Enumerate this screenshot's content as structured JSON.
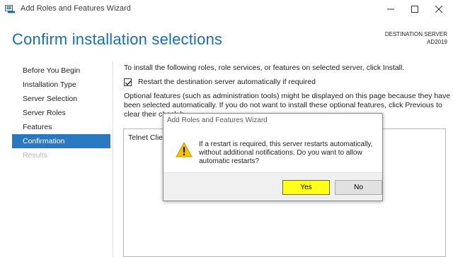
{
  "window": {
    "title": "Add Roles and Features Wizard"
  },
  "header": {
    "page_title": "Confirm installation selections",
    "destination_label": "DESTINATION SERVER",
    "destination_server": "AD2019"
  },
  "nav": {
    "items": [
      {
        "label": "Before You Begin",
        "state": "normal"
      },
      {
        "label": "Installation Type",
        "state": "normal"
      },
      {
        "label": "Server Selection",
        "state": "normal"
      },
      {
        "label": "Server Roles",
        "state": "normal"
      },
      {
        "label": "Features",
        "state": "normal"
      },
      {
        "label": "Confirmation",
        "state": "active"
      },
      {
        "label": "Results",
        "state": "disabled"
      }
    ]
  },
  "main": {
    "intro": "To install the following roles, role services, or features on selected server, click Install.",
    "restart_checkbox": {
      "label": "Restart the destination server automatically if required",
      "checked": true
    },
    "optional_text": "Optional features (such as administration tools) might be displayed on this page because they have been selected automatically. If you do not want to install these optional features, click Previous to clear their check b",
    "features": [
      "Telnet Client"
    ]
  },
  "dialog": {
    "title": "Add Roles and Features Wizard",
    "icon": "warning-icon",
    "message": "If a restart is required, this server restarts automatically, without additional notifications. Do you want to allow automatic restarts?",
    "yes_label": "Yes",
    "no_label": "No"
  },
  "colors": {
    "accent": "#1a6fa8",
    "nav_active": "#2a78c0",
    "highlight": "#ffff1a"
  }
}
